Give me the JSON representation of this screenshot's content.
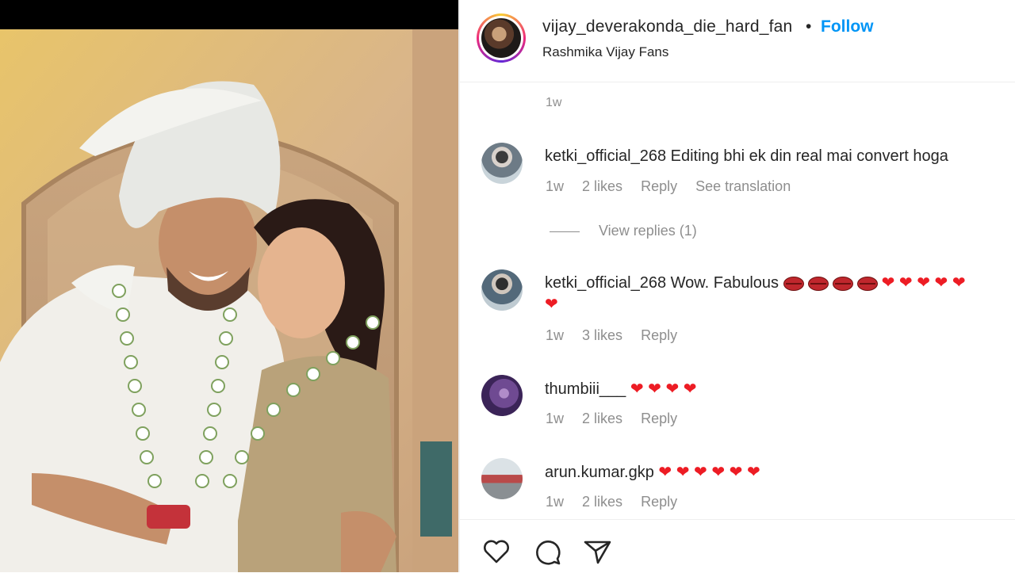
{
  "post_header": {
    "username": "vijay_deverakonda_die_hard_fan",
    "separator": "•",
    "follow_label": "Follow",
    "subtitle": "Rashmika Vijay Fans"
  },
  "caption_time": "1w",
  "comments": [
    {
      "username": "ketki_official_268",
      "text": "Editing bhi ek din real mai convert hoga",
      "time": "1w",
      "likes": "2 likes",
      "reply_label": "Reply",
      "translation_label": "See translation",
      "view_replies": "View replies (1)"
    },
    {
      "username": "ketki_official_268",
      "text": "Wow. Fabulous",
      "emoji_lips_count": 4,
      "emoji_hearts_line1": "❤ ❤ ❤ ❤ ❤",
      "emoji_hearts_line2": "❤",
      "time": "1w",
      "likes": "3 likes",
      "reply_label": "Reply"
    },
    {
      "username": "thumbiii___",
      "emoji_hearts": "❤ ❤ ❤ ❤",
      "time": "1w",
      "likes": "2 likes",
      "reply_label": "Reply"
    },
    {
      "username": "arun.kumar.gkp",
      "emoji_hearts": "❤ ❤ ❤ ❤ ❤ ❤",
      "time": "1w",
      "likes": "2 likes",
      "reply_label": "Reply"
    }
  ],
  "actions": [
    "heart-icon",
    "comment-icon",
    "share-icon"
  ],
  "colors": {
    "follow": "#0095f6",
    "meta_text": "#8e8e8e",
    "heart_emoji": "#ed1c24"
  }
}
